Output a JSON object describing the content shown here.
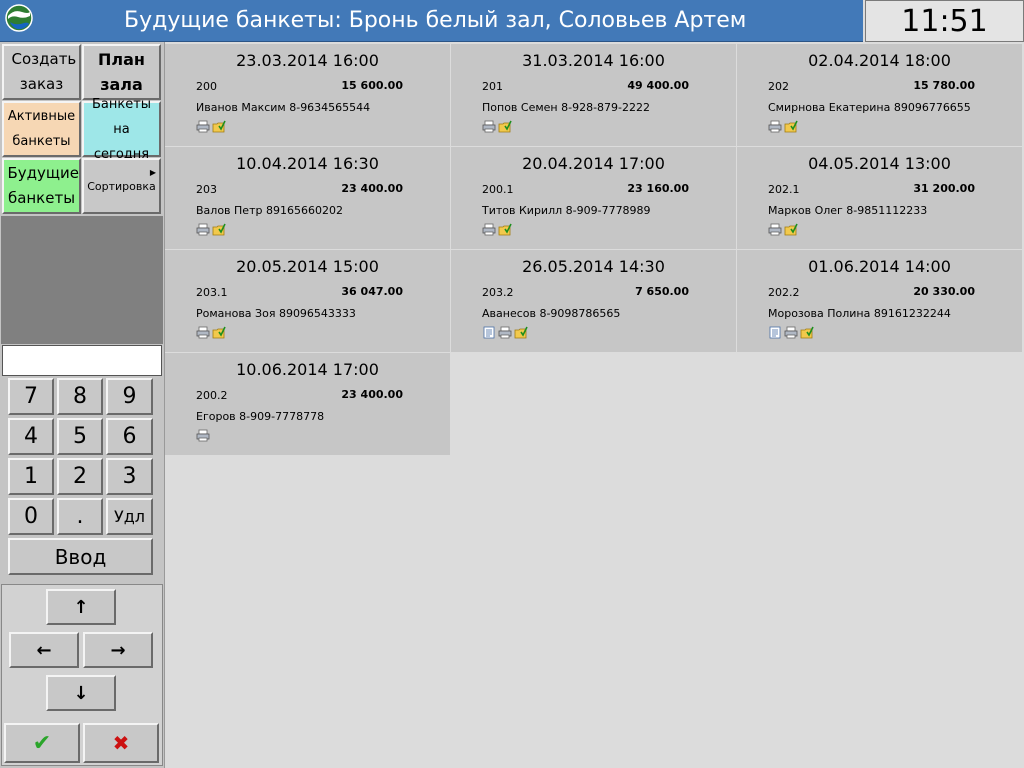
{
  "header": {
    "title": "Будущие банкеты: Бронь белый зал, Соловьев Артем",
    "clock": "11:51",
    "logo_icon": "globe-logo-icon"
  },
  "menu": {
    "create_order": "Создать заказ",
    "hall_plan": "План зала",
    "active_banquets": "Активные банкеты",
    "banquets_today": "Банкеты на сегодня",
    "future_banquets": "Будущие банкеты",
    "sorting": "Сортировка"
  },
  "colors": {
    "title_bar": "#4279b8",
    "active_banquets_bg": "#f6d7b4",
    "banquets_today_bg": "#9ee7e8",
    "future_banquets_bg": "#8ef08e"
  },
  "entry": {
    "value": ""
  },
  "keypad": {
    "k7": "7",
    "k8": "8",
    "k9": "9",
    "k4": "4",
    "k5": "5",
    "k6": "6",
    "k1": "1",
    "k2": "2",
    "k3": "3",
    "k0": "0",
    "kdot": ".",
    "kdel": "Удл",
    "enter": "Ввод"
  },
  "nav": {
    "up": "↑",
    "left": "←",
    "right": "→",
    "down": "↓",
    "ok": "✔",
    "cancel": "✖"
  },
  "banquets": [
    {
      "datetime": "23.03.2014 16:00",
      "number": "200",
      "sum": "15 600.00",
      "client": "Иванов Максим 8-9634565544",
      "icons": [
        "printer-icon",
        "folder-check-icon"
      ]
    },
    {
      "datetime": "31.03.2014 16:00",
      "number": "201",
      "sum": "49 400.00",
      "client": "Попов Семен 8-928-879-2222",
      "icons": [
        "printer-icon",
        "folder-check-icon"
      ]
    },
    {
      "datetime": "02.04.2014 18:00",
      "number": "202",
      "sum": "15 780.00",
      "client": "Смирнова Екатерина 89096776655",
      "icons": [
        "printer-icon",
        "folder-check-icon"
      ]
    },
    {
      "datetime": "10.04.2014 16:30",
      "number": "203",
      "sum": "23 400.00",
      "client": "Валов Петр  89165660202",
      "icons": [
        "printer-icon",
        "folder-check-icon"
      ]
    },
    {
      "datetime": "20.04.2014 17:00",
      "number": "200.1",
      "sum": "23 160.00",
      "client": "Титов Кирилл 8-909-7778989",
      "icons": [
        "printer-icon",
        "folder-check-icon"
      ]
    },
    {
      "datetime": "04.05.2014 13:00",
      "number": "202.1",
      "sum": "31 200.00",
      "client": "Марков Олег 8-9851112233",
      "icons": [
        "printer-icon",
        "folder-check-icon"
      ]
    },
    {
      "datetime": "20.05.2014 15:00",
      "number": "203.1",
      "sum": "36 047.00",
      "client": "Романова Зоя 89096543333",
      "icons": [
        "printer-icon",
        "folder-check-icon"
      ]
    },
    {
      "datetime": "26.05.2014 14:30",
      "number": "203.2",
      "sum": "7 650.00",
      "client": "Аванесов 8-9098786565",
      "icons": [
        "document-icon",
        "printer-icon",
        "folder-check-icon"
      ]
    },
    {
      "datetime": "01.06.2014 14:00",
      "number": "202.2",
      "sum": "20 330.00",
      "client": "Морозова Полина 89161232244",
      "icons": [
        "document-icon",
        "printer-icon",
        "folder-check-icon"
      ]
    },
    {
      "datetime": "10.06.2014 17:00",
      "number": "200.2",
      "sum": "23 400.00",
      "client": "Егоров   8-909-7778778",
      "icons": [
        "printer-icon"
      ]
    }
  ]
}
